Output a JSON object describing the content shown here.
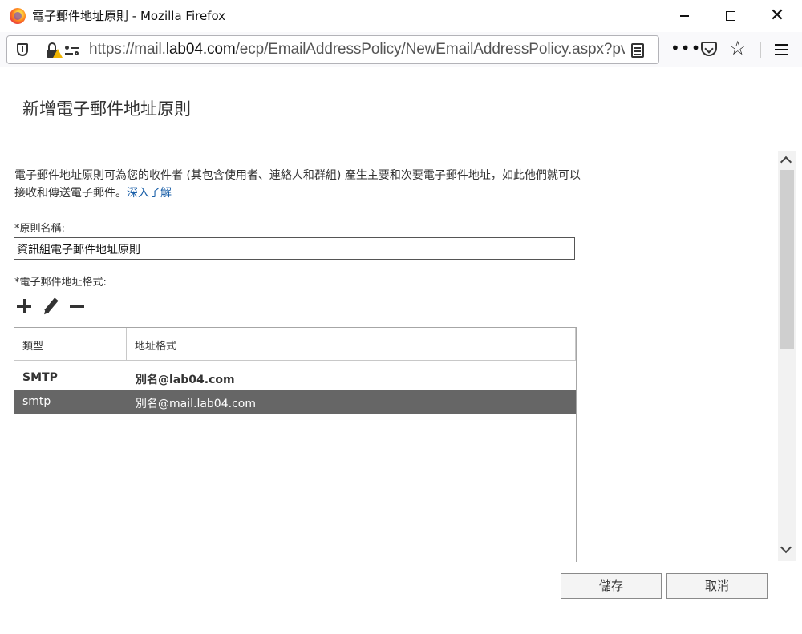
{
  "window": {
    "title": "電子郵件地址原則 - Mozilla Firefox"
  },
  "addressbar": {
    "url_prefix": "https://mail.",
    "url_domain": "lab04.com",
    "url_path": "/ecp/EmailAddressPolicy/NewEmailAddressPolicy.aspx?pv"
  },
  "page": {
    "title": "新增電子郵件地址原則",
    "description": "電子郵件地址原則可為您的收件者 (其包含使用者、連絡人和群組) 產生主要和次要電子郵件地址，如此他們就可以接收和傳送電子郵件。",
    "learn_more": "深入了解",
    "policy_name_label": "*原則名稱:",
    "policy_name_value": "資訊組電子郵件地址原則",
    "address_format_label": "*電子郵件地址格式:"
  },
  "grid": {
    "columns": [
      "類型",
      "地址格式"
    ],
    "rows": [
      {
        "type": "SMTP",
        "format": "別名@lab04.com",
        "selected": false
      },
      {
        "type": "smtp",
        "format": "別名@mail.lab04.com",
        "selected": true
      }
    ]
  },
  "buttons": {
    "save": "儲存",
    "cancel": "取消"
  },
  "colors": {
    "selected_row": "#666666",
    "link": "#1a5fa8"
  }
}
